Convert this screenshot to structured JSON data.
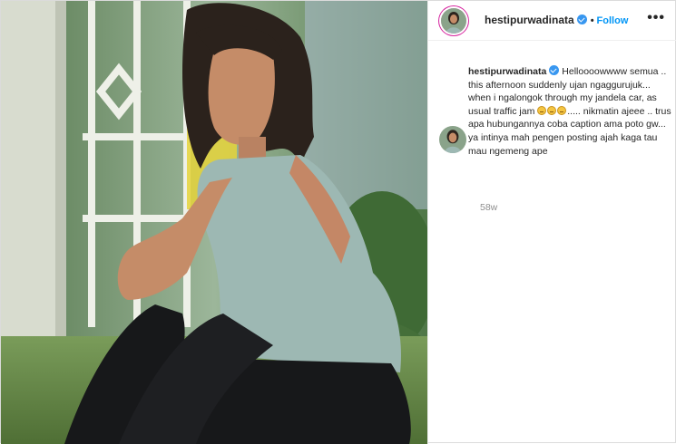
{
  "post": {
    "username": "hestipurwadinata",
    "follow_label": "Follow",
    "separator": "•",
    "more_label": "•••",
    "caption_username": "hestipurwadinata",
    "caption_part1": "Helloooowwww semua .. this afternoon suddenly ujan ngaggurujuk... when i ngalongok through my jandela car, as usual traffic jam",
    "caption_part2": "..... nikmatin ajeee .. trus apa hubungannya coba caption ama poto gw... ya intinya mah pengen posting ajah kaga tau mau ngemeng ape",
    "emoji_count": 3,
    "timestamp": "58w"
  },
  "icons": {
    "verified": "verified-badge-icon",
    "more": "more-options-icon",
    "emoji": "worried-face-emoji-icon"
  },
  "colors": {
    "link_blue": "#0095f6",
    "verified_blue": "#3897f0",
    "text": "#262626",
    "muted": "#8e8e8e"
  }
}
